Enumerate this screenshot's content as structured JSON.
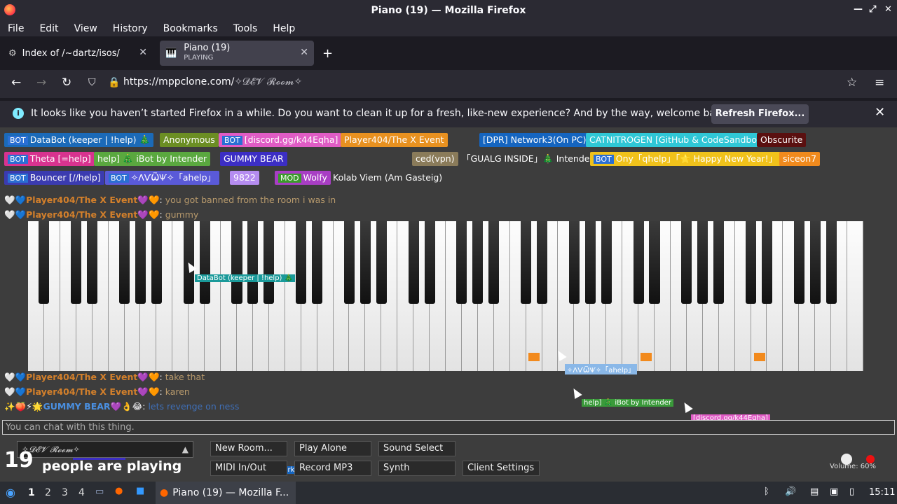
{
  "window": {
    "title": "Piano (19) — Mozilla Firefox"
  },
  "menu": [
    "File",
    "Edit",
    "View",
    "History",
    "Bookmarks",
    "Tools",
    "Help"
  ],
  "tabs": [
    {
      "label": "Index of /~dartz/isos/"
    },
    {
      "label": "Piano (19)",
      "sub": "PLAYING"
    }
  ],
  "url": {
    "domain": "https://mppclone.com/",
    "path": "✧𝓓𝓔𝓥 𝓡𝓸𝓸𝓶✧"
  },
  "notification": {
    "message": "It looks like you haven’t started Firefox in a while. Do you want to clean it up for a fresh, like-new experience? And by the way, welcome back!",
    "button": "Refresh Firefox..."
  },
  "users": {
    "row1": [
      "DataBot (keeper | !help) 🎄",
      "Anonymous",
      "[discord.gg/k44Eqha]",
      "Player404/The X Event",
      "[DPR] Network3(On PC)",
      "CATNITROGEN [GitHub & CodeSandbox]",
      "Obscurite"
    ],
    "row2": [
      "Theta [=help]",
      "help] 🎄 iBot by Intender",
      "GUMMY BEAR",
      "ced(vpn)",
      "「GUALG INSIDE」🎄 Intender",
      "Ony「qhelp」「🌟 Happy New Year!」",
      "siceon7"
    ],
    "row3": [
      "Bouncer [//help]",
      "✧ɅѴѾѰ✧「ahelp」",
      "9822",
      "Wolfy",
      "Kolab Viem (Am Gasteig)"
    ],
    "bot": "BOT",
    "mod": "MOD"
  },
  "chat": [
    {
      "name": "Player404/The X Event",
      "msg": "you got banned from the room i was in"
    },
    {
      "name": "Player404/The X Event",
      "msg": "gummy"
    },
    {
      "name": "Player404/The X Event",
      "msg": "take that"
    },
    {
      "name": "Player404/The X Event",
      "msg": "karen"
    },
    {
      "name": "GUMMY BEAR",
      "msg": "lets revenge on ness"
    }
  ],
  "chat_placeholder": "You can chat with this thing.",
  "room": "✧𝓓𝓔𝓥 𝓡𝓸𝓸𝓶✧",
  "players": {
    "count": "19",
    "label": "people are playing"
  },
  "buttons": {
    "new_room": "New Room...",
    "play_alone": "Play Alone",
    "sound_select": "Sound Select",
    "midi": "MIDI In/Out",
    "record": "Record MP3",
    "synth": "Synth",
    "client_settings": "Client Settings"
  },
  "volume": "Volume: 60%",
  "taskbar": {
    "workspaces": [
      "1",
      "2",
      "3",
      "4"
    ],
    "app": "Piano (19) — Mozilla F...",
    "clock": "15:11"
  }
}
